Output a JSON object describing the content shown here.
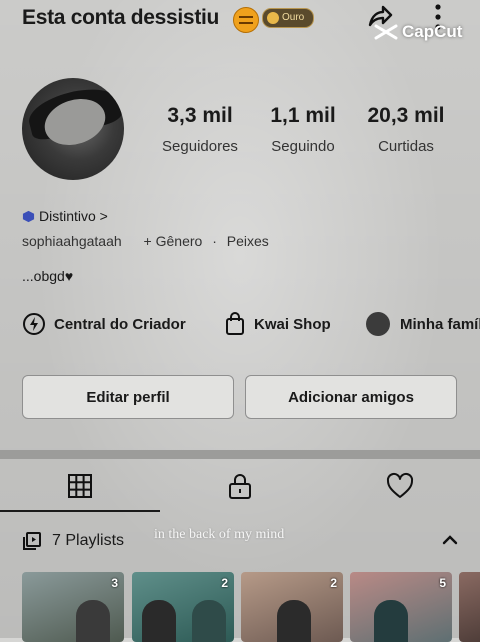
{
  "header": {
    "username": "Esta conta dessistiu",
    "badge_label": "Ouro",
    "share_icon": "share-arrow-icon",
    "more_icon": "more-vertical-icon"
  },
  "watermark": {
    "text": "CapCut",
    "icon": "capcut-logo-icon"
  },
  "profile": {
    "stats": [
      {
        "value": "3,3 mil",
        "label": "Seguidores"
      },
      {
        "value": "1,1 mil",
        "label": "Seguindo"
      },
      {
        "value": "20,3 mil",
        "label": "Curtidas"
      }
    ],
    "distintivo": "Distintivo >",
    "handle": "sophiaahgataah",
    "gender": "+ Gênero",
    "separator": "·",
    "sign": "Peixes",
    "bio": "...obgd♥"
  },
  "shortcuts": [
    {
      "label": "Central do Criador",
      "icon": "lightning-circle-icon"
    },
    {
      "label": "Kwai Shop",
      "icon": "shopping-bag-icon"
    },
    {
      "label": "Minha família",
      "icon": "family-avatar-icon"
    }
  ],
  "buttons": {
    "edit": "Editar perfil",
    "add_friends": "Adicionar amigos"
  },
  "tabs": [
    {
      "name": "grid",
      "icon": "grid-icon",
      "active": true
    },
    {
      "name": "private",
      "icon": "lock-icon",
      "active": false
    },
    {
      "name": "liked",
      "icon": "heart-icon",
      "active": false
    }
  ],
  "playlists": {
    "label": "7 Playlists",
    "icon": "playlist-icon",
    "lyric_overlay": "in the back of my mind",
    "items": [
      {
        "count": "3"
      },
      {
        "count": "2"
      },
      {
        "count": "2"
      },
      {
        "count": "5"
      }
    ]
  },
  "colors": {
    "background": "#d6d6d4",
    "badge": "#5a4a2c",
    "accent_blue": "#3b4fb8",
    "text": "#1a1a1a"
  }
}
